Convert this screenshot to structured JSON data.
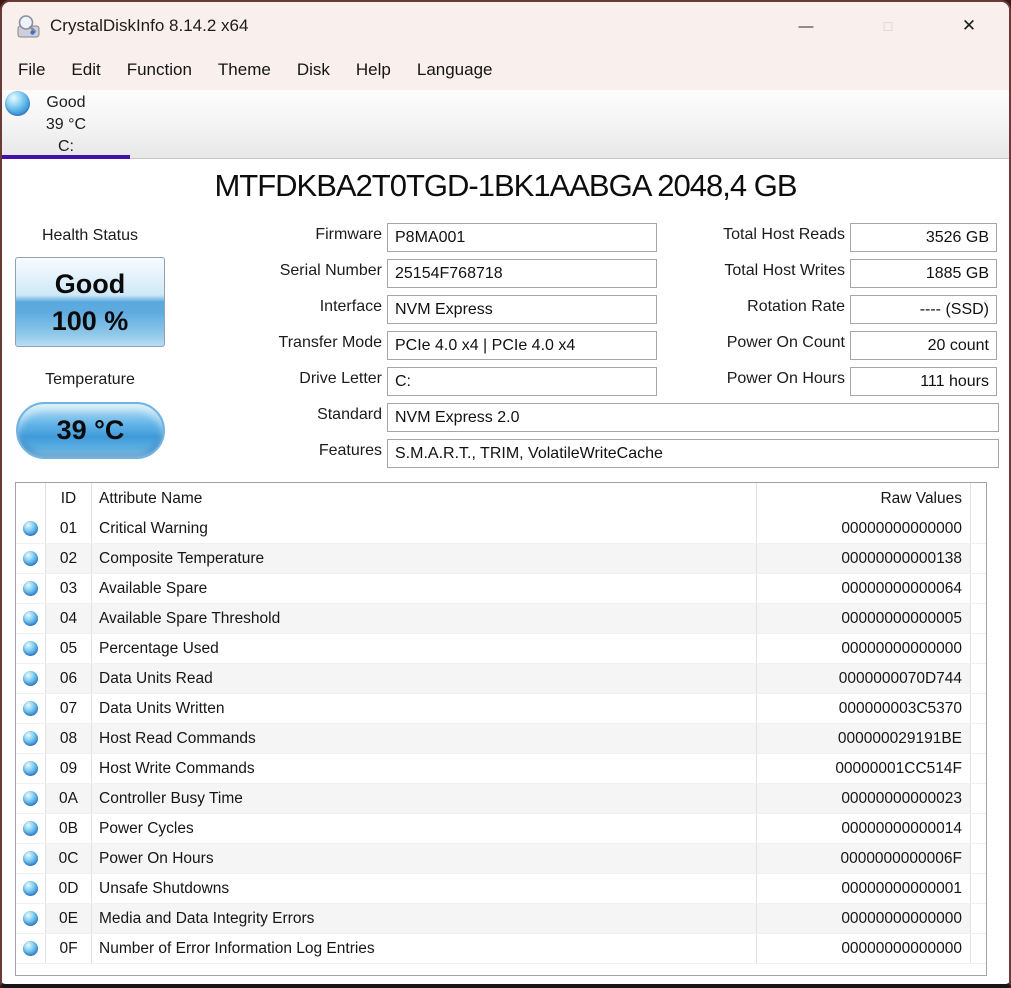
{
  "window": {
    "title": "CrystalDiskInfo 8.14.2 x64",
    "icons": {
      "minimize": "—",
      "maximize": "□",
      "close": "✕"
    }
  },
  "menu": {
    "items": [
      "File",
      "Edit",
      "Function",
      "Theme",
      "Disk",
      "Help",
      "Language"
    ]
  },
  "drive_tab": {
    "status": "Good",
    "temperature": "39 °C",
    "letter": "C:"
  },
  "drive": {
    "model": "MTFDKBA2T0TGD-1BK1AABGA 2048,4 GB",
    "health": {
      "label": "Health Status",
      "status": "Good",
      "percent": "100 %"
    },
    "temperature": {
      "label": "Temperature",
      "value": "39 °C"
    },
    "info_fields": [
      {
        "label": "Firmware",
        "value": "P8MA001",
        "wide": false
      },
      {
        "label": "Serial Number",
        "value": "25154F768718",
        "wide": false
      },
      {
        "label": "Interface",
        "value": "NVM Express",
        "wide": false
      },
      {
        "label": "Transfer Mode",
        "value": "PCIe 4.0 x4 | PCIe 4.0 x4",
        "wide": false
      },
      {
        "label": "Drive Letter",
        "value": "C:",
        "wide": false
      },
      {
        "label": "Standard",
        "value": "NVM Express 2.0",
        "wide": true
      },
      {
        "label": "Features",
        "value": "S.M.A.R.T., TRIM, VolatileWriteCache",
        "wide": true
      }
    ],
    "stat_fields": [
      {
        "label": "Total Host Reads",
        "value": "3526 GB"
      },
      {
        "label": "Total Host Writes",
        "value": "1885 GB"
      },
      {
        "label": "Rotation Rate",
        "value": "---- (SSD)"
      },
      {
        "label": "Power On Count",
        "value": "20 count"
      },
      {
        "label": "Power On Hours",
        "value": "111 hours"
      }
    ]
  },
  "table": {
    "headers": {
      "id": "ID",
      "attribute": "Attribute Name",
      "raw": "Raw Values"
    },
    "rows": [
      {
        "id": "01",
        "attribute": "Critical Warning",
        "raw": "00000000000000"
      },
      {
        "id": "02",
        "attribute": "Composite Temperature",
        "raw": "00000000000138"
      },
      {
        "id": "03",
        "attribute": "Available Spare",
        "raw": "00000000000064"
      },
      {
        "id": "04",
        "attribute": "Available Spare Threshold",
        "raw": "00000000000005"
      },
      {
        "id": "05",
        "attribute": "Percentage Used",
        "raw": "00000000000000"
      },
      {
        "id": "06",
        "attribute": "Data Units Read",
        "raw": "0000000070D744"
      },
      {
        "id": "07",
        "attribute": "Data Units Written",
        "raw": "000000003C5370"
      },
      {
        "id": "08",
        "attribute": "Host Read Commands",
        "raw": "000000029191BE"
      },
      {
        "id": "09",
        "attribute": "Host Write Commands",
        "raw": "00000001CC514F"
      },
      {
        "id": "0A",
        "attribute": "Controller Busy Time",
        "raw": "00000000000023"
      },
      {
        "id": "0B",
        "attribute": "Power Cycles",
        "raw": "00000000000014"
      },
      {
        "id": "0C",
        "attribute": "Power On Hours",
        "raw": "0000000000006F"
      },
      {
        "id": "0D",
        "attribute": "Unsafe Shutdowns",
        "raw": "00000000000001"
      },
      {
        "id": "0E",
        "attribute": "Media and Data Integrity Errors",
        "raw": "00000000000000"
      },
      {
        "id": "0F",
        "attribute": "Number of Error Information Log Entries",
        "raw": "00000000000000"
      }
    ]
  },
  "colors": {
    "titlebar_background": "#F9EFED",
    "tab_underline_accent": "#4210AB",
    "health_button_blue": "#58A6DD",
    "orb_blue": "#49A5E1"
  }
}
